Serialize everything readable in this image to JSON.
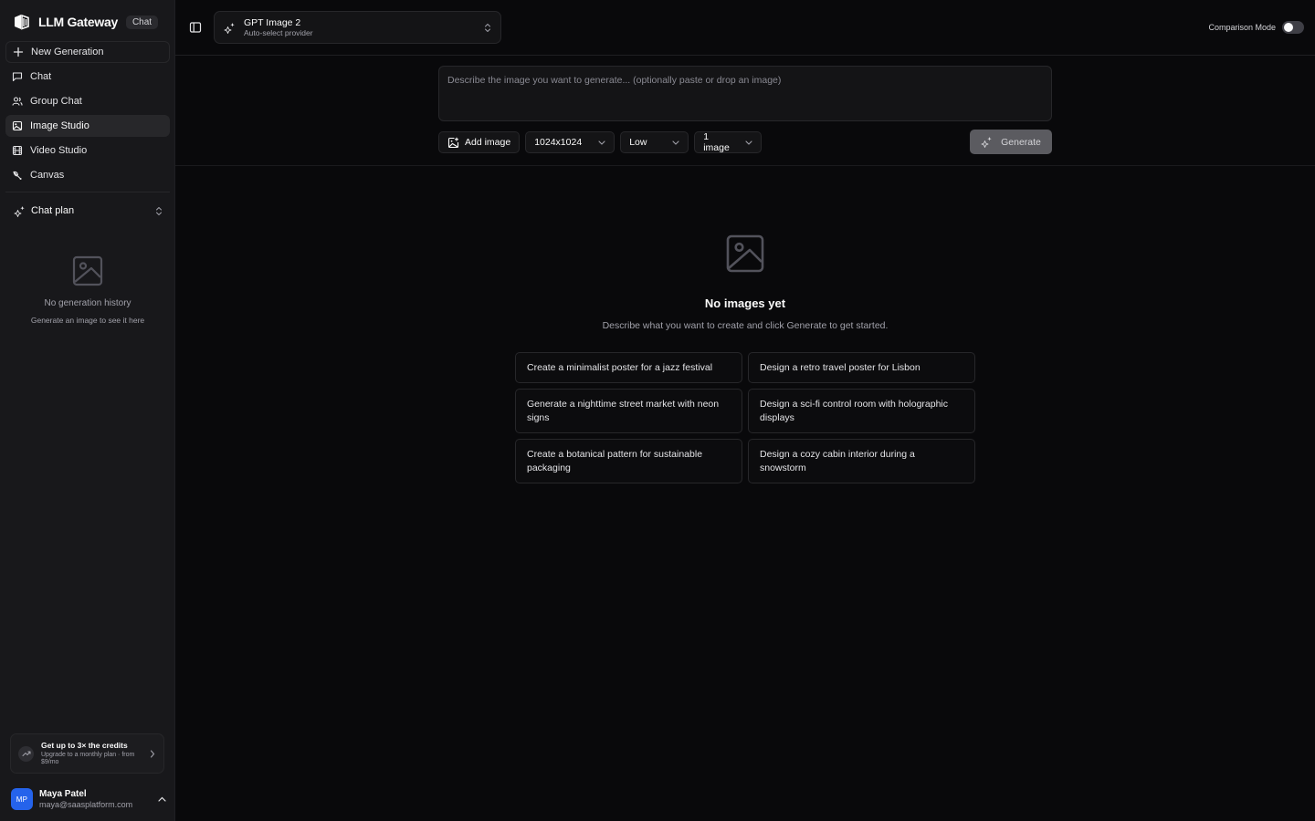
{
  "brand": {
    "name": "LLM Gateway",
    "badge": "Chat"
  },
  "sidebar": {
    "items": [
      {
        "label": "New Generation",
        "icon": "plus-icon"
      },
      {
        "label": "Chat",
        "icon": "message-square-icon"
      },
      {
        "label": "Group Chat",
        "icon": "users-icon"
      },
      {
        "label": "Image Studio",
        "icon": "image-icon"
      },
      {
        "label": "Video Studio",
        "icon": "film-icon"
      },
      {
        "label": "Canvas",
        "icon": "brush-icon"
      }
    ],
    "active_item": "Image Studio",
    "plan": {
      "label": "Chat plan",
      "icon": "sparkles-icon"
    },
    "history_empty": {
      "title": "No generation history",
      "subtitle": "Generate an image to see it here"
    },
    "promo": {
      "title": "Get up to 3× the credits",
      "subtitle": "Upgrade to a monthly plan · from $9/mo"
    },
    "user": {
      "initials": "MP",
      "name": "Maya Patel",
      "email": "maya@saasplatform.com"
    }
  },
  "topbar": {
    "model": {
      "name": "GPT Image 2",
      "provider": "Auto-select provider"
    },
    "comparison_mode": {
      "label": "Comparison Mode",
      "enabled": false
    }
  },
  "composer": {
    "placeholder": "Describe the image you want to generate... (optionally paste or drop an image)",
    "add_image_label": "Add image",
    "size": "1024x1024",
    "quality": "Low",
    "count": "1 image",
    "generate_label": "Generate"
  },
  "empty_state": {
    "title": "No images yet",
    "subtitle": "Describe what you want to create and click Generate to get started."
  },
  "suggestions": [
    "Create a minimalist poster for a jazz festival",
    "Design a retro travel poster for Lisbon",
    "Generate a nighttime street market with neon signs",
    "Design a sci-fi control room with holographic displays",
    "Create a botanical pattern for sustainable packaging",
    "Design a cozy cabin interior during a snowstorm"
  ],
  "colors": {
    "background": "#09090b",
    "sidebar": "#18181b",
    "border": "#27272a",
    "avatar": "#2563eb",
    "generate_button": "#5b5b60"
  }
}
